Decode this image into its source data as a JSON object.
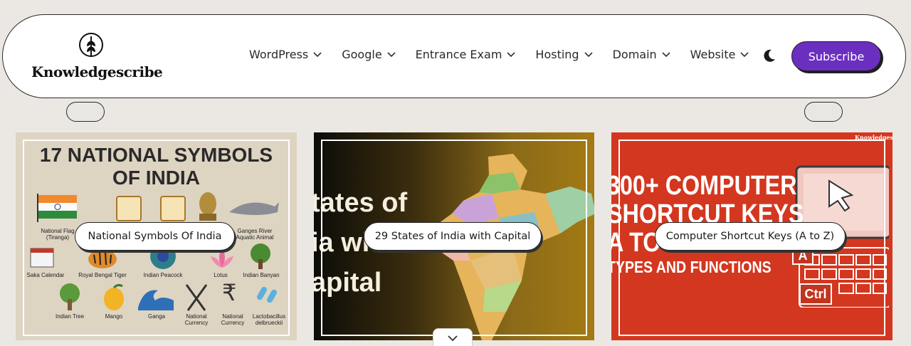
{
  "site": {
    "name": "Knowledgescribe"
  },
  "nav": {
    "items": [
      {
        "label": "WordPress",
        "icon": "chevron-down-icon"
      },
      {
        "label": "Google",
        "icon": "chevron-down-icon"
      },
      {
        "label": "Entrance Exam",
        "icon": "chevron-down-icon"
      },
      {
        "label": "Hosting",
        "icon": "chevron-down-icon"
      },
      {
        "label": "Domain",
        "icon": "chevron-down-icon"
      },
      {
        "label": "Website",
        "icon": "chevron-down-icon"
      }
    ],
    "theme_toggle_icon": "moon-icon",
    "subscribe_label": "Subscribe"
  },
  "colors": {
    "accent": "#6b2fc0",
    "card1_bg": "#ded4c2",
    "card3_bg": "#d3371f"
  },
  "cards": [
    {
      "caption": "National Symbols Of India",
      "image": {
        "title_line1": "17 NATIONAL SYMBOLS",
        "title_line2": "OF INDIA",
        "labels": [
          "National Flag (Tiranga)",
          "Ganges River Aquatic Animal",
          "Saka Calendar",
          "Royal Bengal Tiger",
          "Indian Peacock",
          "Lotus",
          "Indian Banyan",
          "Indian Tree",
          "Mango",
          "Ganga",
          "National Currency",
          "National Currency",
          "Lactobacillus delbrueckii"
        ]
      }
    },
    {
      "caption": "29 States of India with Capital",
      "image": {
        "line1": "tates of",
        "line2": "ia with",
        "line3": "apital"
      }
    },
    {
      "caption": "Computer Shortcut Keys (A to Z)",
      "image": {
        "line1": "300+ COMPUTER",
        "line2": "SHORTCUT KEYS",
        "line3": "A TO Z",
        "line4": "TYPES AND FUNCTIONS",
        "key_a": "A",
        "key_ctrl": "Ctrl",
        "brand": "Knowledges"
      }
    }
  ]
}
